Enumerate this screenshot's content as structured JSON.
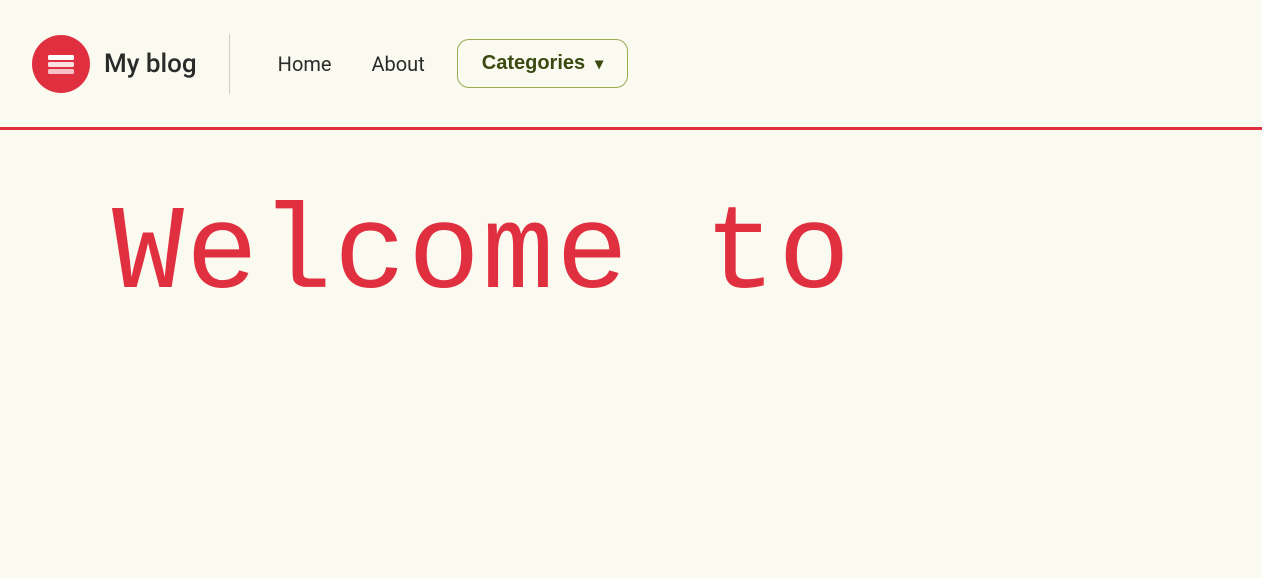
{
  "brand": {
    "name": "My blog",
    "logo_icon": "layers-icon"
  },
  "nav": {
    "home_label": "Home",
    "about_label": "About",
    "categories_label": "Categories",
    "chevron": "▾"
  },
  "main": {
    "welcome_text": "Welcome to"
  },
  "colors": {
    "accent": "#e03040",
    "background": "#fafaf0",
    "categories_border": "#9aaa50",
    "categories_text": "#3a4a10"
  }
}
